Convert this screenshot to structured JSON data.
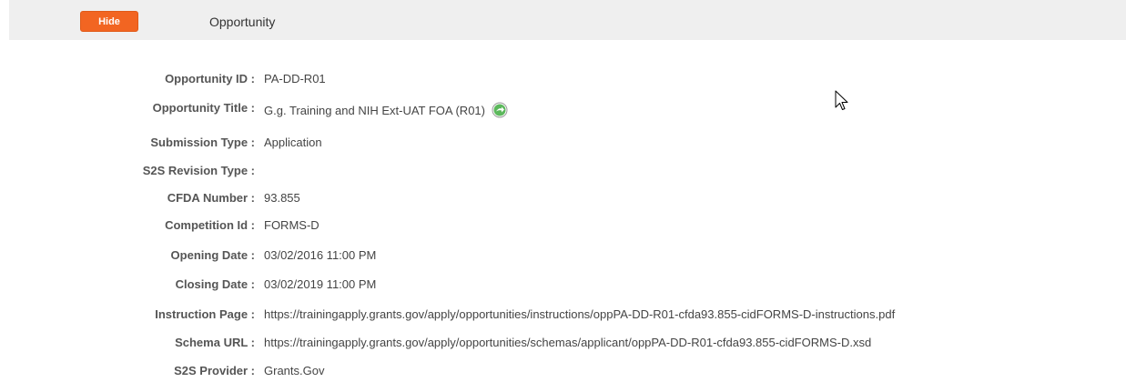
{
  "header": {
    "hide_label": "Hide",
    "section_title": "Opportunity"
  },
  "fields": [
    {
      "label": "Opportunity ID :",
      "value": "PA-DD-R01"
    },
    {
      "label": "Opportunity Title :",
      "value": "G.g. Training and NIH Ext-UAT FOA (R01)"
    },
    {
      "label": "Submission Type :",
      "value": "Application"
    },
    {
      "label": "S2S Revision Type :",
      "value": ""
    },
    {
      "label": "CFDA Number :",
      "value": "93.855"
    },
    {
      "label": "Competition Id :",
      "value": "FORMS-D"
    },
    {
      "label": "Opening Date :",
      "value": "03/02/2016 11:00 PM"
    },
    {
      "label": "Closing Date :",
      "value": "03/02/2019 11:00 PM"
    },
    {
      "label": "Instruction Page :",
      "value": "https://trainingapply.grants.gov/apply/opportunities/instructions/oppPA-DD-R01-cfda93.855-cidFORMS-D-instructions.pdf"
    },
    {
      "label": "Schema URL :",
      "value": "https://trainingapply.grants.gov/apply/opportunities/schemas/applicant/oppPA-DD-R01-cfda93.855-cidFORMS-D.xsd"
    },
    {
      "label": "S2S Provider :",
      "value": "Grants.Gov"
    }
  ],
  "icons": {
    "title_link": "go-arrow-icon",
    "pointer": "mouse-cursor-icon"
  },
  "colors": {
    "hide_button": "#f26522",
    "header_bar": "#efefef",
    "go_icon": "#4caf50"
  }
}
